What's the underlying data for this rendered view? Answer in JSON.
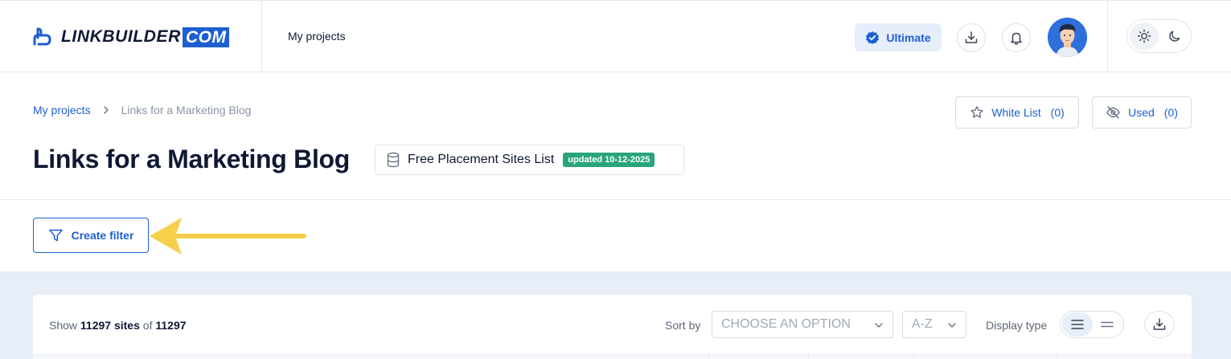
{
  "header": {
    "logo_text": "LINKBUILDER",
    "logo_suffix": "COM",
    "nav_link": "My projects",
    "plan_label": "Ultimate",
    "icons": {
      "download": "download-icon",
      "bell": "bell-icon",
      "sun": "sun-icon",
      "moon": "moon-icon"
    }
  },
  "breadcrumb": {
    "root": "My projects",
    "current": "Links for a Marketing Blog"
  },
  "page": {
    "title": "Links for a Marketing Blog",
    "list_name": "Free Placement Sites List",
    "updated_badge": "updated 10-12-2025"
  },
  "actions": {
    "white_list_label": "White List",
    "white_list_count": "(0)",
    "used_label": "Used",
    "used_count": "(0)",
    "create_filter_label": "Create filter"
  },
  "toolbar": {
    "show_prefix": "Show",
    "shown_count": "11297 sites",
    "of_text": "of",
    "total_count": "11297",
    "sort_label": "Sort by",
    "sort_placeholder": "CHOOSE AN OPTION",
    "order_value": "A-Z",
    "display_label": "Display type"
  },
  "colors": {
    "accent": "#1d5fd1",
    "badge_green": "#2aa57a",
    "arrow_yellow": "#f6cf4b",
    "panel_bg": "#e8eef8"
  }
}
